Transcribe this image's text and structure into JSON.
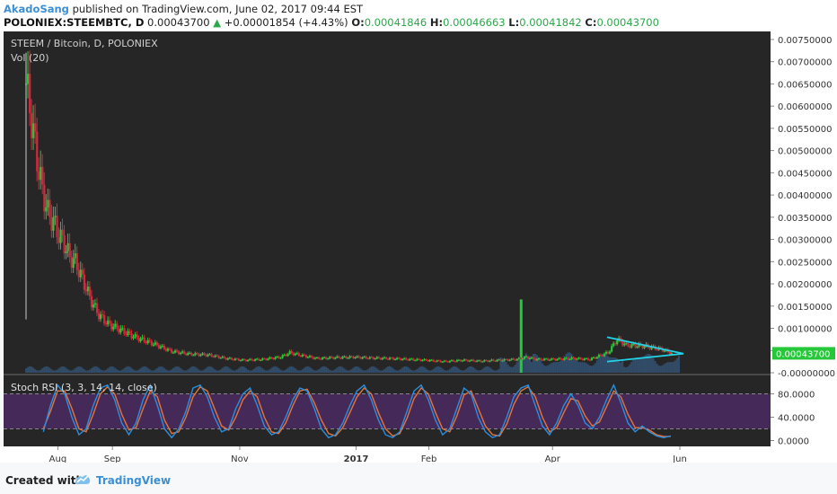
{
  "header": {
    "author": "AkadoSang",
    "published": "published on TradingView.com, June 02, 2017 09:44 EST",
    "symbol": "POLONIEX:STEEMBTC, D",
    "last": "0.00043700",
    "change": "+0.00001854 (+4.43%)",
    "o_label": "O:",
    "o_value": "0.00041846",
    "h_label": "H:",
    "h_value": "0.00046663",
    "l_label": "L:",
    "l_value": "0.00041842",
    "c_label": "C:",
    "c_value": "0.00043700"
  },
  "footer": {
    "created": "Created with",
    "brand": "TradingView"
  },
  "colors": {
    "up": "#26c83a",
    "down": "#d7263d",
    "background": "#262626",
    "triangle": "#22d3e8",
    "stoch_k": "#2a8fe0",
    "stoch_d": "#e6733a",
    "stoch_band": "#4b2c63"
  },
  "chart_data": {
    "type": "candlestick",
    "title": "STEEM / Bitcoin, D, POLONIEX",
    "volume_label": "Vol (20)",
    "x_ticks": [
      "Aug",
      "Sep",
      "Nov",
      "2017",
      "Feb",
      "Apr",
      "Jun"
    ],
    "y_ticks": [
      "0.00750000",
      "0.00700000",
      "0.00650000",
      "0.00600000",
      "0.00550000",
      "0.00500000",
      "0.00450000",
      "0.00400000",
      "0.00350000",
      "0.00300000",
      "0.00250000",
      "0.00200000",
      "0.00150000",
      "0.00100000",
      "0.00050000",
      "-0.00000000"
    ],
    "ylim": [
      0,
      0.0076
    ],
    "last_price": "0.00043700",
    "price_series": [
      {
        "t": 0,
        "p": 0.0065
      },
      {
        "t": 3,
        "p": 0.0057
      },
      {
        "t": 6,
        "p": 0.0048
      },
      {
        "t": 9,
        "p": 0.0041
      },
      {
        "t": 12,
        "p": 0.0036
      },
      {
        "t": 15,
        "p": 0.0034
      },
      {
        "t": 18,
        "p": 0.0031
      },
      {
        "t": 21,
        "p": 0.0029
      },
      {
        "t": 24,
        "p": 0.0026
      },
      {
        "t": 27,
        "p": 0.0025
      },
      {
        "t": 30,
        "p": 0.0022
      },
      {
        "t": 33,
        "p": 0.0019
      },
      {
        "t": 36,
        "p": 0.0016
      },
      {
        "t": 40,
        "p": 0.0013
      },
      {
        "t": 45,
        "p": 0.0011
      },
      {
        "t": 50,
        "p": 0.001
      },
      {
        "t": 55,
        "p": 0.0009
      },
      {
        "t": 60,
        "p": 0.0008
      },
      {
        "t": 70,
        "p": 0.00065
      },
      {
        "t": 80,
        "p": 0.00048
      },
      {
        "t": 90,
        "p": 0.00042
      },
      {
        "t": 100,
        "p": 0.0004
      },
      {
        "t": 110,
        "p": 0.00032
      },
      {
        "t": 120,
        "p": 0.00028
      },
      {
        "t": 130,
        "p": 0.0003
      },
      {
        "t": 140,
        "p": 0.00035
      },
      {
        "t": 145,
        "p": 0.00045
      },
      {
        "t": 150,
        "p": 0.0004
      },
      {
        "t": 160,
        "p": 0.00032
      },
      {
        "t": 170,
        "p": 0.00034
      },
      {
        "t": 180,
        "p": 0.00035
      },
      {
        "t": 190,
        "p": 0.00033
      },
      {
        "t": 200,
        "p": 0.00032
      },
      {
        "t": 210,
        "p": 0.0003
      },
      {
        "t": 220,
        "p": 0.00028
      },
      {
        "t": 230,
        "p": 0.00025
      },
      {
        "t": 240,
        "p": 0.00028
      },
      {
        "t": 250,
        "p": 0.00026
      },
      {
        "t": 260,
        "p": 0.00028
      },
      {
        "t": 270,
        "p": 0.0003
      },
      {
        "t": 275,
        "p": 0.00035
      },
      {
        "t": 280,
        "p": 0.0003
      },
      {
        "t": 290,
        "p": 0.0003
      },
      {
        "t": 300,
        "p": 0.00032
      },
      {
        "t": 310,
        "p": 0.0003
      },
      {
        "t": 320,
        "p": 0.00045
      },
      {
        "t": 325,
        "p": 0.00075
      },
      {
        "t": 330,
        "p": 0.00062
      },
      {
        "t": 340,
        "p": 0.0006
      },
      {
        "t": 350,
        "p": 0.00052
      },
      {
        "t": 355,
        "p": 0.00043
      }
    ],
    "triangle": [
      [
        320,
        0.0008
      ],
      [
        362,
        0.00043
      ],
      [
        320,
        0.00025
      ]
    ],
    "volume_spikes": [
      {
        "t": 272,
        "v": 1.0
      },
      {
        "t": 275,
        "v": 0.45
      },
      {
        "t": 278,
        "v": 0.25
      },
      {
        "t": 328,
        "v": 0.3
      }
    ],
    "stoch_rsi": {
      "label": "Stoch RSI (3, 3, 14, 14, close)",
      "y_ticks": [
        "80.0000",
        "40.0000",
        "0.0000"
      ],
      "ylim": [
        -10,
        110
      ],
      "band": [
        20,
        80
      ],
      "k": [
        15,
        60,
        95,
        80,
        40,
        10,
        20,
        60,
        90,
        95,
        70,
        30,
        10,
        30,
        70,
        95,
        60,
        20,
        5,
        20,
        50,
        90,
        95,
        75,
        40,
        15,
        20,
        55,
        80,
        90,
        60,
        25,
        10,
        15,
        40,
        70,
        90,
        85,
        55,
        20,
        5,
        10,
        30,
        60,
        85,
        95,
        70,
        35,
        10,
        5,
        15,
        50,
        85,
        95,
        70,
        35,
        10,
        20,
        55,
        90,
        80,
        40,
        15,
        5,
        10,
        40,
        75,
        90,
        95,
        60,
        25,
        10,
        30,
        60,
        80,
        60,
        30,
        20,
        40,
        70,
        95,
        65,
        30,
        15,
        25,
        15,
        8,
        5,
        8
      ],
      "d": [
        20,
        50,
        85,
        85,
        55,
        20,
        15,
        45,
        80,
        92,
        80,
        45,
        18,
        22,
        55,
        85,
        75,
        35,
        12,
        15,
        40,
        75,
        92,
        85,
        55,
        25,
        18,
        40,
        70,
        85,
        75,
        40,
        15,
        12,
        30,
        60,
        85,
        88,
        65,
        35,
        12,
        8,
        22,
        48,
        75,
        90,
        80,
        48,
        20,
        8,
        12,
        38,
        72,
        90,
        80,
        48,
        20,
        15,
        42,
        78,
        85,
        55,
        25,
        10,
        8,
        28,
        62,
        85,
        92,
        75,
        40,
        15,
        22,
        48,
        72,
        68,
        42,
        25,
        32,
        58,
        85,
        75,
        45,
        22,
        22,
        18,
        10,
        7,
        7
      ]
    }
  }
}
